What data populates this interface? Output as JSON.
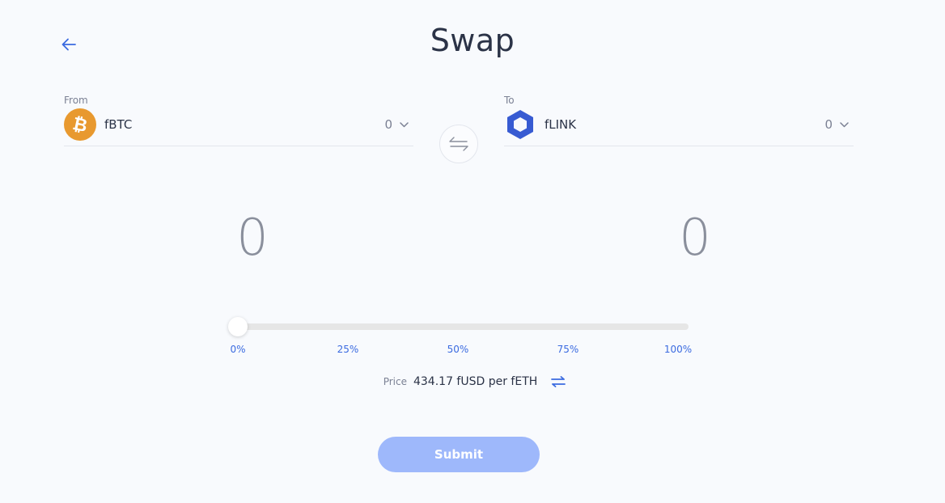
{
  "header": {
    "title": "Swap",
    "back_icon": "arrow-left-icon"
  },
  "from": {
    "label": "From",
    "token": "fBTC",
    "icon": "bitcoin-icon",
    "balance": "0",
    "amount": "0"
  },
  "to": {
    "label": "To",
    "token": "fLINK",
    "icon": "chainlink-icon",
    "balance": "0",
    "amount": "0"
  },
  "swap_direction_icon": "swap-arrows-icon",
  "slider": {
    "value_percent": 0,
    "marks": [
      "0%",
      "25%",
      "50%",
      "75%",
      "100%"
    ]
  },
  "price": {
    "label": "Price",
    "value": "434.17 fUSD per fETH",
    "toggle_icon": "swap-arrows-icon"
  },
  "submit": {
    "label": "Submit"
  },
  "colors": {
    "background": "#f8fafd",
    "accent": "#3b6be0",
    "submit_disabled": "#9eb8fb",
    "bitcoin": "#e8992f",
    "chainlink": "#375bd2"
  }
}
